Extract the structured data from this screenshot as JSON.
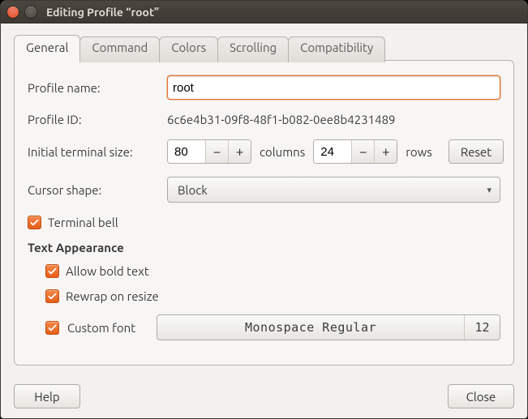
{
  "window": {
    "title": "Editing Profile “root”"
  },
  "tabs": {
    "items": [
      "General",
      "Command",
      "Colors",
      "Scrolling",
      "Compatibility"
    ],
    "active": 0
  },
  "general": {
    "profile_name": {
      "label": "Profile name:",
      "value": "root"
    },
    "profile_id": {
      "label": "Profile ID:",
      "value": "6c6e4b31-09f8-48f1-b082-0ee8b4231489"
    },
    "init_size": {
      "label": "Initial terminal size:",
      "cols": 80,
      "cols_label": "columns",
      "rows": 24,
      "rows_label": "rows",
      "reset": "Reset"
    },
    "cursor_shape": {
      "label": "Cursor shape:",
      "value": "Block"
    },
    "terminal_bell": {
      "label": "Terminal bell",
      "checked": true
    },
    "text_appearance": {
      "heading": "Text Appearance",
      "allow_bold": {
        "label": "Allow bold text",
        "checked": true
      },
      "rewrap": {
        "label": "Rewrap on resize",
        "checked": true
      },
      "custom_font": {
        "label": "Custom font",
        "checked": true,
        "font_name": "Monospace Regular",
        "font_size": 12
      }
    }
  },
  "footer": {
    "help": "Help",
    "close": "Close"
  },
  "spinner": {
    "minus": "−",
    "plus": "+"
  },
  "arrow_down": "▾"
}
